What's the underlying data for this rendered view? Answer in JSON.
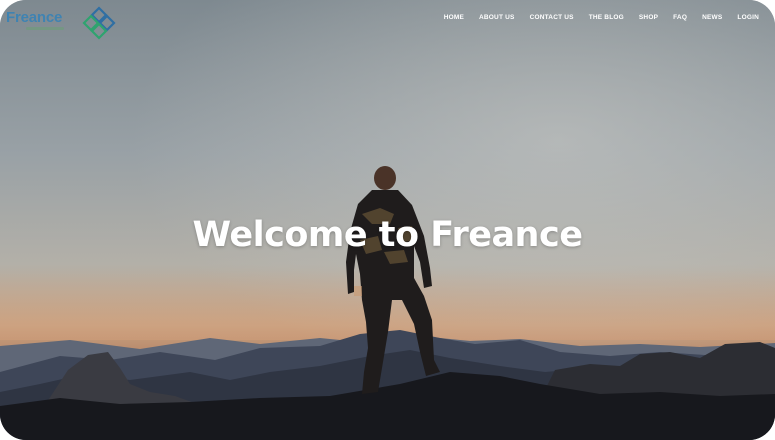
{
  "brand": {
    "name": "Freance",
    "logo_icon": "brand-mark-icon",
    "colors": {
      "logo_text": "#3f83b2",
      "logo_mark_blue": "#2f6fa3",
      "logo_mark_green": "#2fa36f"
    }
  },
  "nav": {
    "items": [
      "HOME",
      "ABOUT US",
      "CONTACT US",
      "THE BLOG",
      "SHOP",
      "FAQ",
      "NEWS",
      "LOGIN"
    ]
  },
  "hero": {
    "title": "Welcome to Freance"
  }
}
